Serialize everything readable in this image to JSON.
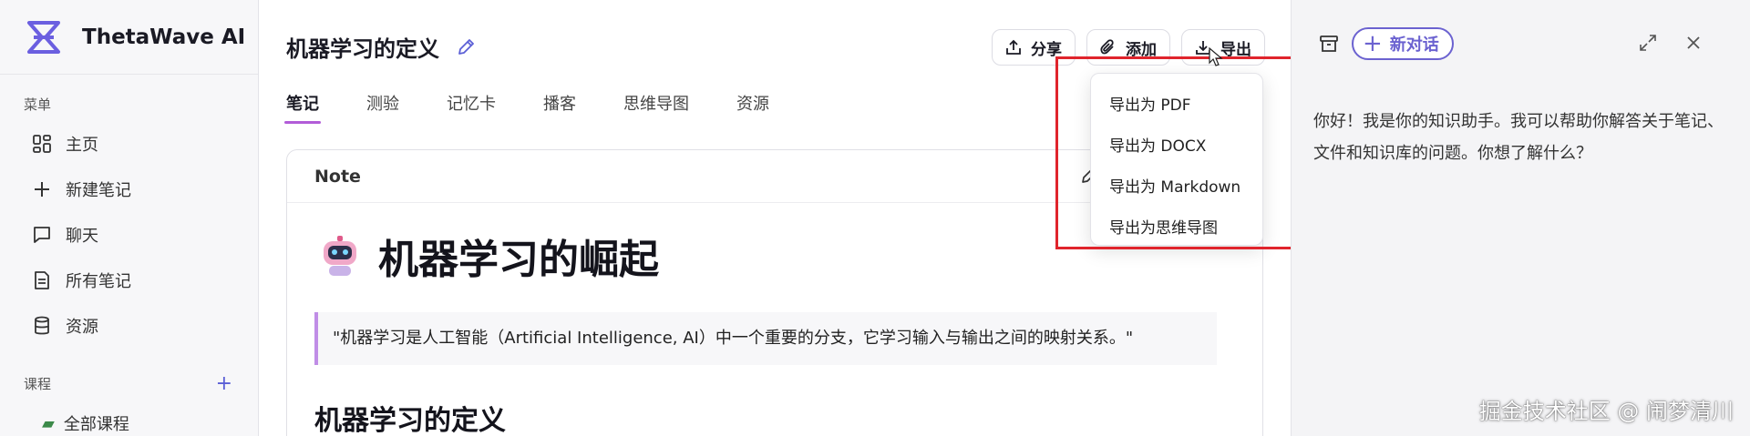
{
  "brand": {
    "name": "ThetaWave AI",
    "logo_color": "#6b5fe0"
  },
  "sidebar": {
    "menu_label": "菜单",
    "items": [
      {
        "label": "主页",
        "icon": "grid-icon"
      },
      {
        "label": "新建笔记",
        "icon": "plus-icon"
      },
      {
        "label": "聊天",
        "icon": "chat-bubble-icon"
      },
      {
        "label": "所有笔记",
        "icon": "document-icon"
      },
      {
        "label": "资源",
        "icon": "database-icon"
      }
    ],
    "courses_label": "课程",
    "courses_add": "+",
    "course_item": "全部课程"
  },
  "note": {
    "title": "机器学习的定义",
    "toolbar": {
      "share": "分享",
      "add": "添加",
      "export": "导出"
    },
    "tabs": [
      "笔记",
      "测验",
      "记忆卡",
      "播客",
      "思维导图",
      "资源"
    ],
    "active_tab": 0,
    "card_header": "Note",
    "heading": "机器学习的崛起",
    "quote": "\"机器学习是人工智能（Artificial Intelligence, AI）中一个重要的分支，它学习输入与输出之间的映射关系。\"",
    "subheading_cut": "机器学习的定义"
  },
  "export_menu": {
    "items": [
      "导出为 PDF",
      "导出为 DOCX",
      "导出为 Markdown",
      "导出为思维导图"
    ]
  },
  "chat": {
    "new_chat": "新对话",
    "greeting": "你好！我是你的知识助手。我可以帮助你解答关于笔记、文件和知识库的问题。你想了解什么？"
  },
  "watermark": "掘金技术社区 @ 闹梦清川",
  "colors": {
    "accent": "#6b62d0",
    "tab_underline": "#b25cd8",
    "highlight_box": "#e0242c"
  }
}
